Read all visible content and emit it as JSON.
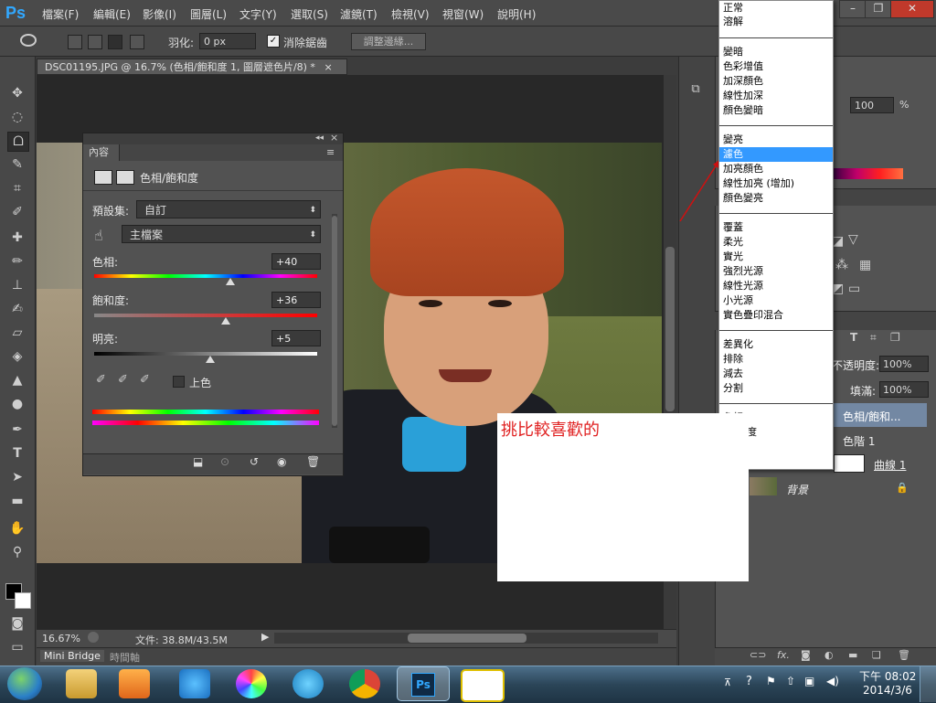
{
  "app": {
    "logo": "Ps",
    "menu": [
      "檔案(F)",
      "編輯(E)",
      "影像(I)",
      "圖層(L)",
      "文字(Y)",
      "選取(S)",
      "濾鏡(T)",
      "檢視(V)",
      "視窗(W)",
      "說明(H)"
    ],
    "window_buttons": [
      "–",
      "❐",
      "✕"
    ]
  },
  "options_bar": {
    "feather_label": "羽化:",
    "feather_value": "0 px",
    "antialias_label": "消除鋸齒",
    "antialias_checked": true,
    "refine_edge_button": "調整邊緣..."
  },
  "document": {
    "tab_title": "DSC01195.JPG @ 16.7% (色相/飽和度 1, 圖層遮色片/8) *",
    "tab_close": "×"
  },
  "properties_panel": {
    "tab_label": "內容",
    "collapse": "◂◂",
    "close": "×",
    "adjustment_title": "色相/飽和度",
    "preset_label": "預設集:",
    "preset_value": "自訂",
    "channel_value": "主檔案",
    "hue_label": "色相:",
    "hue_value": "+40",
    "hue_level": 0.61,
    "saturation_label": "飽和度:",
    "saturation_value": "+36",
    "saturation_level": 0.59,
    "lightness_label": "明亮:",
    "lightness_value": "+5",
    "lightness_level": 0.52,
    "colorize_label": "上色",
    "colorize_checked": false
  },
  "status_bar": {
    "zoom": "16.67%",
    "doc_info": "文件: 38.8M/43.5M",
    "mini_bridge_tab": "Mini Bridge",
    "timeline_tab": "時間軸"
  },
  "blend_menu": {
    "groups": [
      [
        "正常",
        "溶解"
      ],
      [
        "變暗",
        "色彩增值",
        "加深顏色",
        "線性加深",
        "顏色變暗"
      ],
      [
        "變亮",
        "濾色",
        "加亮顏色",
        "線性加亮 (增加)",
        "顏色變亮"
      ],
      [
        "覆蓋",
        "柔光",
        "實光",
        "強烈光源",
        "線性光源",
        "小光源",
        "實色疊印混合"
      ],
      [
        "差異化",
        "排除",
        "減去",
        "分割"
      ],
      [
        "色相",
        "..."
      ]
    ],
    "selected": "濾色",
    "partial_visible": "度"
  },
  "layers_panel": {
    "opacity_value_top": "100",
    "percent": "%",
    "opacity_label": "不透明度:",
    "opacity_value": "100%",
    "fill_label": "填滿:",
    "fill_value": "100%",
    "layers": [
      {
        "name": "色相/飽和...",
        "selected": true
      },
      {
        "name": "色階 1",
        "selected": false
      },
      {
        "name": "曲線 1",
        "selected": false
      },
      {
        "name": "背景",
        "selected": false,
        "locked": true
      }
    ]
  },
  "annotation": {
    "text": "挑比較喜歡的",
    "color": "#e02020"
  },
  "taskbar": {
    "time": "下午 08:02",
    "date": "2014/3/6"
  }
}
